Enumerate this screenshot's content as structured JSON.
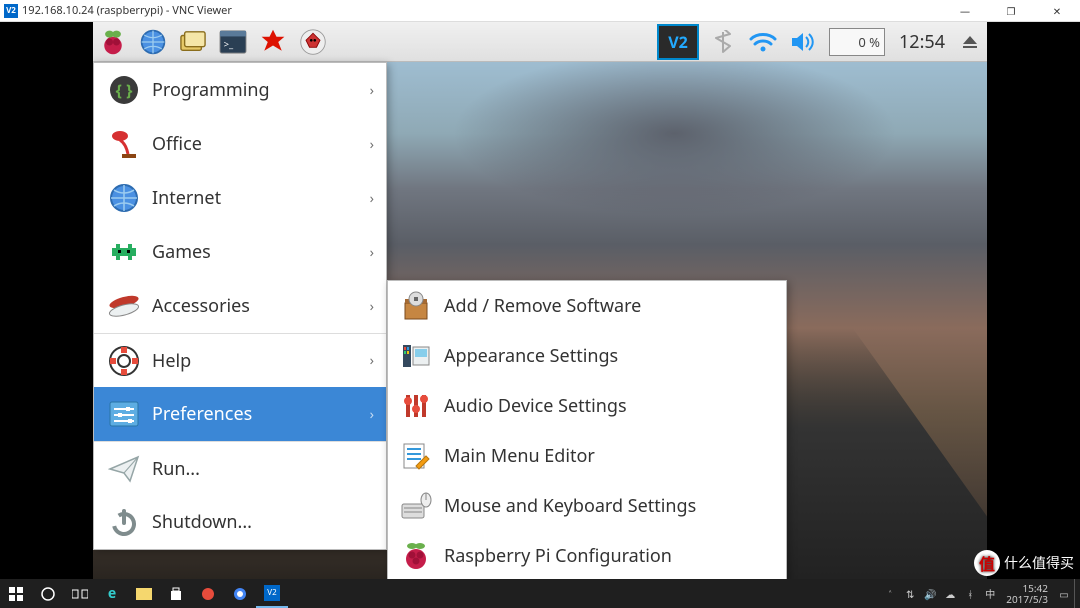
{
  "host_window": {
    "title": "192.168.10.24 (raspberrypi) - VNC Viewer",
    "app_icon_text": "V2",
    "controls": {
      "min": "—",
      "max": "❐",
      "close": "✕"
    }
  },
  "pi_taskbar": {
    "left_icons": [
      {
        "name": "start-menu-icon",
        "glyph": "pi"
      },
      {
        "name": "browser-icon",
        "glyph": "globe"
      },
      {
        "name": "file-manager-icon",
        "glyph": "folders"
      },
      {
        "name": "terminal-icon",
        "glyph": "terminal"
      },
      {
        "name": "mathematica-icon",
        "glyph": "spiky"
      },
      {
        "name": "wolfram-icon",
        "glyph": "wolf"
      }
    ],
    "vnc_label": "V2",
    "cpu_label": "0 %",
    "clock": "12:54"
  },
  "main_menu": {
    "items": [
      {
        "label": "Programming",
        "icon": "code-icon",
        "arrow": true
      },
      {
        "label": "Office",
        "icon": "lamp-icon",
        "arrow": true
      },
      {
        "label": "Internet",
        "icon": "globe-icon",
        "arrow": true
      },
      {
        "label": "Games",
        "icon": "invader-icon",
        "arrow": true
      },
      {
        "label": "Accessories",
        "icon": "knife-icon",
        "arrow": true
      },
      {
        "label": "Help",
        "icon": "lifebuoy-icon",
        "arrow": true,
        "sep": true
      },
      {
        "label": "Preferences",
        "icon": "sliders-icon",
        "arrow": true,
        "selected": true
      },
      {
        "label": "Run...",
        "icon": "paperplane-icon",
        "arrow": false,
        "sep": true
      },
      {
        "label": "Shutdown...",
        "icon": "power-icon",
        "arrow": false
      }
    ],
    "arrow_glyph": "›"
  },
  "submenu": {
    "items": [
      {
        "label": "Add / Remove Software",
        "icon": "package-icon"
      },
      {
        "label": "Appearance Settings",
        "icon": "palette-icon"
      },
      {
        "label": "Audio Device Settings",
        "icon": "mixer-icon"
      },
      {
        "label": "Main Menu Editor",
        "icon": "menu-editor-icon"
      },
      {
        "label": "Mouse and Keyboard Settings",
        "icon": "mouse-keyboard-icon"
      },
      {
        "label": "Raspberry Pi Configuration",
        "icon": "raspberry-icon"
      }
    ]
  },
  "win_taskbar": {
    "tray_time": "15:42",
    "tray_date": "2017/5/3"
  },
  "watermark": {
    "badge": "值",
    "text": "什么值得买"
  }
}
